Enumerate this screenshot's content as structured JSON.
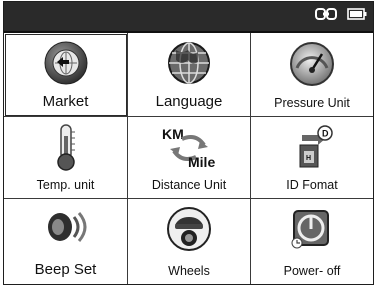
{
  "status": {
    "link_icon": "link-icon",
    "battery_icon": "battery-icon"
  },
  "menu": [
    {
      "label": "Market",
      "icon": "globe-arrow-icon",
      "selected": true
    },
    {
      "label": "Language",
      "icon": "globe-icon",
      "selected": false
    },
    {
      "label": "Pressure Unit",
      "icon": "gauge-icon",
      "selected": false
    },
    {
      "label": "Temp. unit",
      "icon": "thermometer-icon",
      "selected": false
    },
    {
      "label": "Distance Unit",
      "icon": "km-mile-convert-icon",
      "selected": false,
      "icon_text_top": "KM",
      "icon_text_bottom": "Mile"
    },
    {
      "label": "ID Fomat",
      "icon": "id-format-icon",
      "selected": false,
      "icon_badge_d": "D",
      "icon_badge_h": "H"
    },
    {
      "label": "Beep Set",
      "icon": "speaker-icon",
      "selected": false
    },
    {
      "label": "Wheels",
      "icon": "car-wheel-icon",
      "selected": false
    },
    {
      "label": "Power- off",
      "icon": "power-icon",
      "selected": false
    }
  ]
}
